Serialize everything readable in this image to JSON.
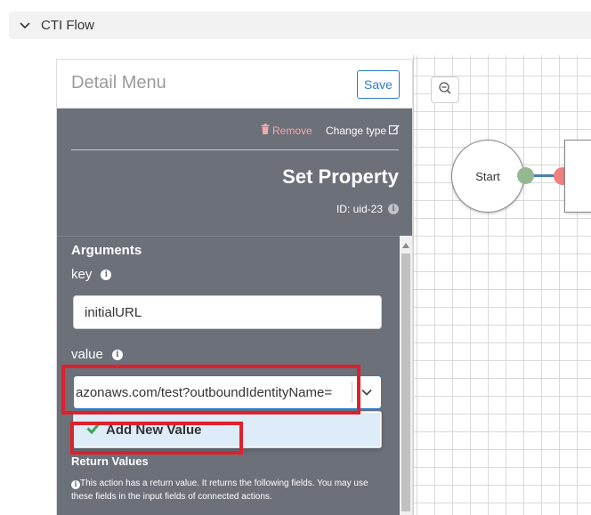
{
  "section": {
    "title": "CTI Flow"
  },
  "panel": {
    "title": "Detail Menu",
    "save_label": "Save",
    "remove_label": "Remove",
    "change_type_label": "Change type",
    "node_title": "Set Property",
    "node_id": "ID: uid-23"
  },
  "arguments": {
    "heading": "Arguments",
    "key_label": "key",
    "key_value": "initialURL",
    "value_label": "value",
    "value_text": "azonaws.com/test?outboundIdentityName=",
    "dropdown_option": "Add New Value"
  },
  "return_values": {
    "heading": "Return Values",
    "description": "This action has a return value. It returns the following fields. You may use these fields in the input fields of connected actions."
  },
  "canvas": {
    "start_label": "Start"
  },
  "colors": {
    "panel_body": "#6b7079",
    "accent": "#2b7bd0",
    "remove": "#f4a9a9",
    "port_green": "#93b892",
    "port_red": "#f08080",
    "connector": "#4a7fb5",
    "highlight": "#e0202a",
    "option_hover": "#deebf9"
  },
  "icons": [
    "chevron-down-icon",
    "zoom-out-icon",
    "trash-icon",
    "edit-icon",
    "info-icon",
    "checkmark-icon",
    "caret-down-icon",
    "scroll-up-icon"
  ]
}
